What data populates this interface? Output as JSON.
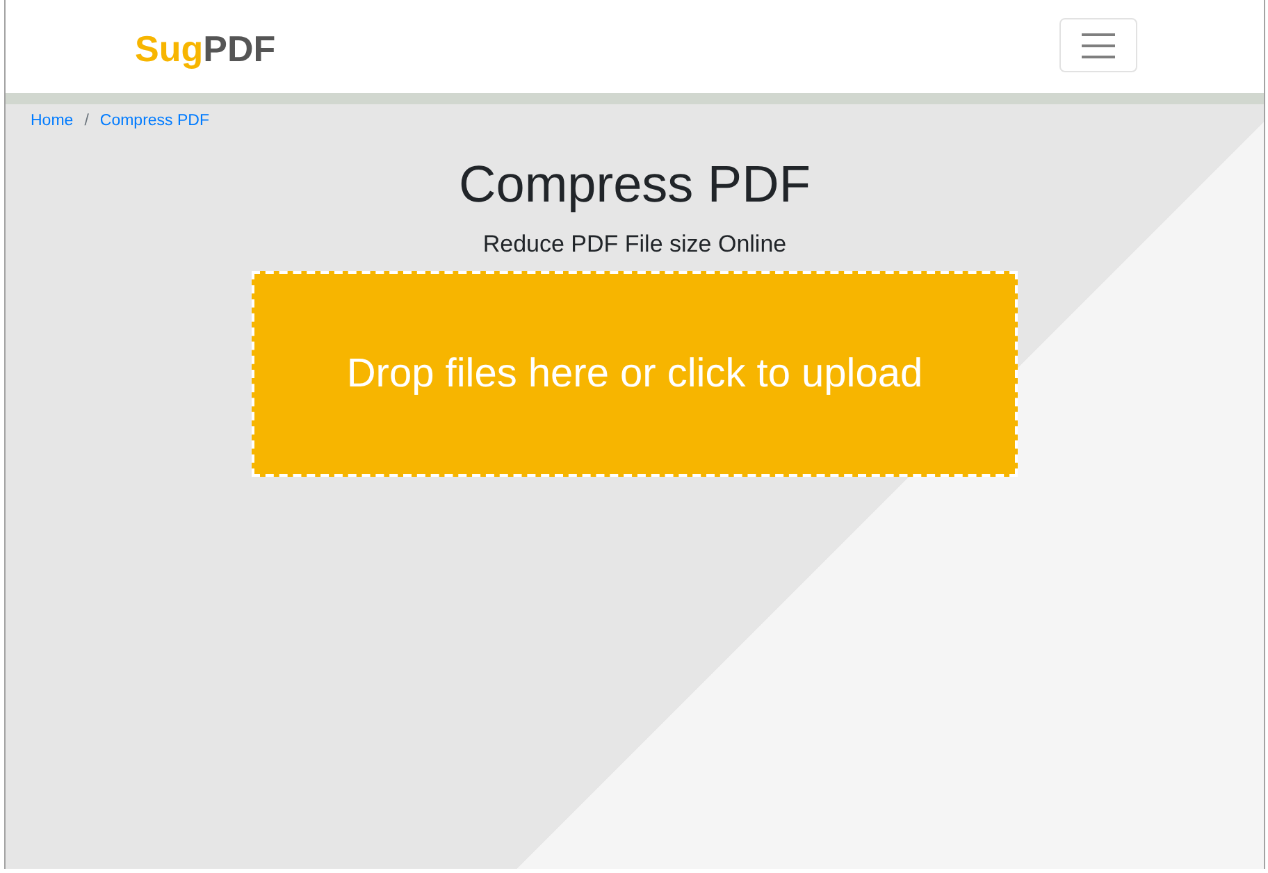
{
  "navbar": {
    "logo": {
      "accent": "Sug",
      "rest": "PDF"
    }
  },
  "breadcrumb": {
    "separator": "/",
    "items": [
      {
        "label": "Home"
      },
      {
        "label": "Compress PDF"
      }
    ]
  },
  "heading": "Compress PDF",
  "subheading": "Reduce PDF File size Online",
  "upload_zone": {
    "prompt": "Drop files here or click to upload"
  }
}
